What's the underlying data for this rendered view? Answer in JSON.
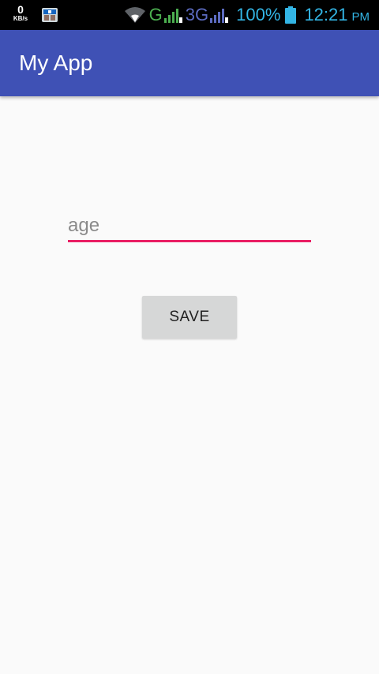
{
  "status_bar": {
    "net_speed_value": "0",
    "net_speed_unit": "KB/s",
    "g_label": "G",
    "threeg_label": "3G",
    "battery_percent": "100%",
    "time": "12:21",
    "ampm": "PM",
    "icons": [
      "notification-icon",
      "wifi-icon",
      "signal-icon",
      "signal-icon",
      "battery-icon"
    ],
    "colors": {
      "g": "#4caf50",
      "threeg": "#5c6bc0",
      "clock": "#33b5e5"
    }
  },
  "app_bar": {
    "title": "My App",
    "color": "#3f51b5"
  },
  "form": {
    "age_placeholder": "age",
    "age_value": "",
    "underline_color": "#e91e63",
    "save_label": "SAVE"
  }
}
